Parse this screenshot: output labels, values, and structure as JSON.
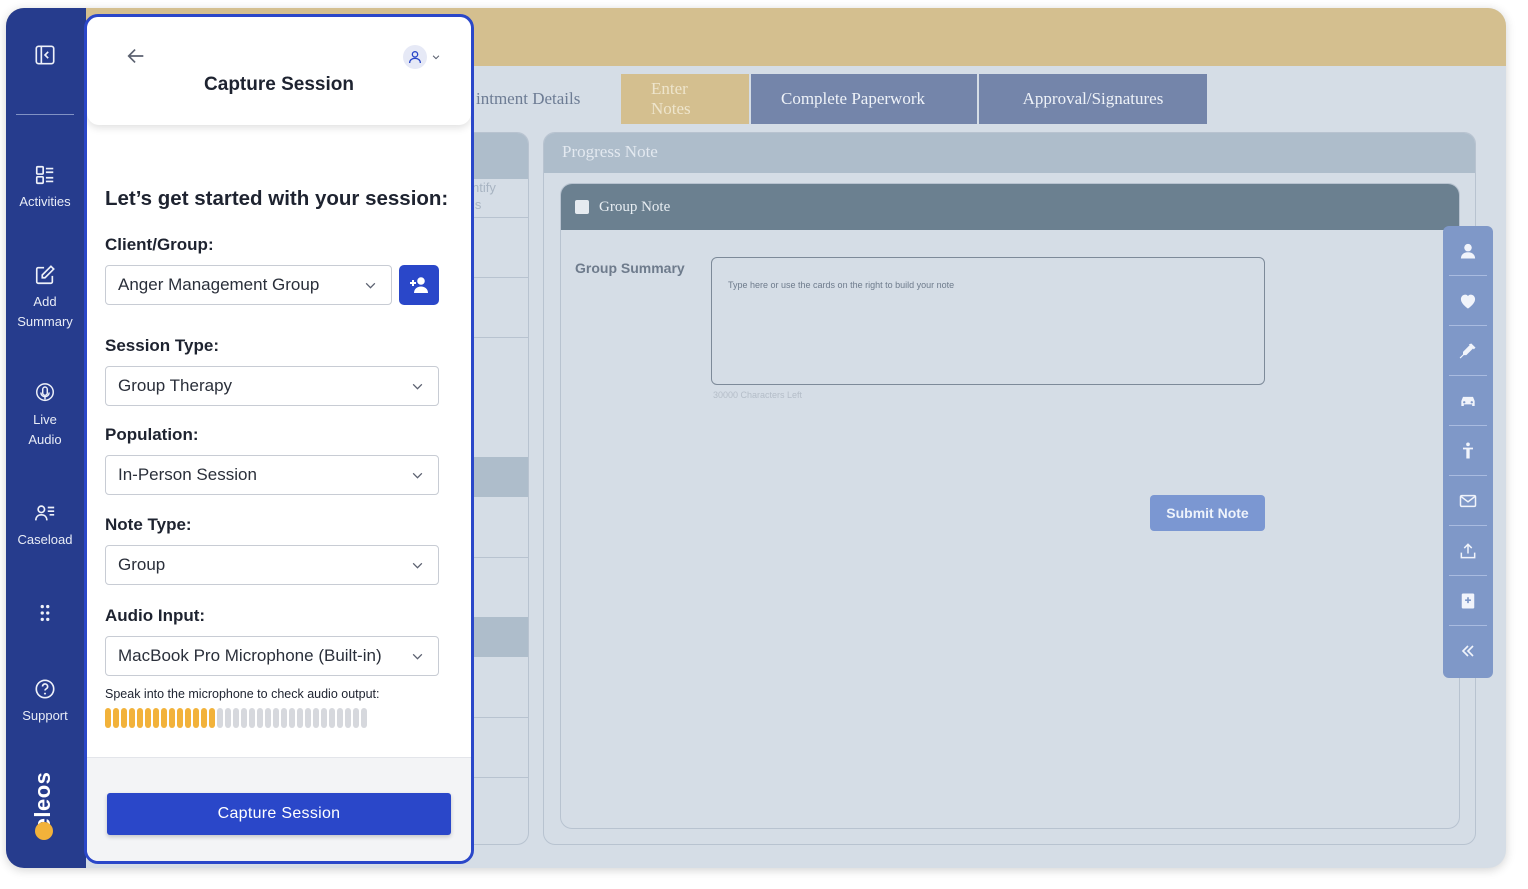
{
  "app": {
    "tabs": [
      {
        "label": "intment Details"
      },
      {
        "label": "Enter Notes"
      },
      {
        "label": "Complete Paperwork"
      },
      {
        "label": "Approval/Signatures"
      }
    ],
    "left_column_ghost": "ntify\nls",
    "progress_note": {
      "title": "Progress Note",
      "group_note_label": "Group Note",
      "group_summary_label": "Group Summary",
      "group_summary_placeholder": "Type here or use the cards on the right to build your note",
      "characters_left": "30000 Characters Left",
      "submit_label": "Submit Note"
    },
    "right_toolbar_icons": [
      "person-icon",
      "heart-icon",
      "syringe-icon",
      "car-icon",
      "figure-icon",
      "mail-icon",
      "upload-icon",
      "medical-book-icon",
      "double-chevron-left-icon"
    ]
  },
  "nav": {
    "items": [
      {
        "label": "Activities",
        "icon": "activities-icon"
      },
      {
        "label": "Add\nSummary",
        "icon": "edit-icon"
      },
      {
        "label": "Live\nAudio",
        "icon": "microphone-icon"
      },
      {
        "label": "Caseload",
        "icon": "caseload-icon"
      },
      {
        "label": "",
        "icon": "grid-dots-icon"
      },
      {
        "label": "Support",
        "icon": "help-icon"
      }
    ],
    "logo_text": "eleos"
  },
  "panel": {
    "title": "Capture Session",
    "intro": "Let’s get started with your session:",
    "client_label": "Client/Group:",
    "client_value": "Anger Management Group",
    "session_type_label": "Session Type:",
    "session_type_value": "Group Therapy",
    "population_label": "Population:",
    "population_value": "In-Person Session",
    "note_type_label": "Note Type:",
    "note_type_value": "Group",
    "audio_input_label": "Audio Input:",
    "audio_input_value": "MacBook Pro Microphone (Built-in)",
    "audio_hint": "Speak into the microphone to check audio output:",
    "audio_level_segments_on": 14,
    "audio_level_segments_total": 33,
    "capture_button_label": "Capture Session"
  },
  "colors": {
    "nav_bg": "#263c8d",
    "accent": "#2a47c9",
    "meter_on": "#f2b23a",
    "topbar": "#d4bf8f"
  }
}
